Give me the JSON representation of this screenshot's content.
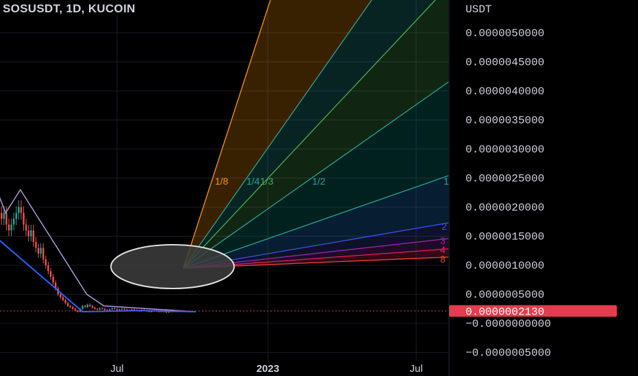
{
  "header": {
    "symbol_line": "SOSUSDT, 1D, KUCOIN"
  },
  "colors": {
    "background": "#000000",
    "up": "#26a69a",
    "down": "#ef5350",
    "price_tag": "#e53b4f",
    "text": "#d1d4dc"
  },
  "chart_data": {
    "type": "candlestick",
    "title": "SOSUSDT, 1D, KUCOIN",
    "ylabel": "USDT",
    "ylim": [
      -6e-07,
      6e-06
    ],
    "yticks": [
      "0.0000050000",
      "0.0000045000",
      "0.0000040000",
      "0.0000035000",
      "0.0000030000",
      "0.0000025000",
      "0.0000020000",
      "0.0000015000",
      "0.0000010000",
      "0.0000005000",
      "−0.0000000000",
      "−0.0000005000"
    ],
    "ytick_values": [
      5e-06,
      4.5e-06,
      4e-06,
      3.5e-06,
      3e-06,
      2.5e-06,
      2e-06,
      1.5e-06,
      1e-06,
      5e-07,
      0.0,
      -5e-07
    ],
    "xticks": [
      "Jul",
      "2023",
      "Jul"
    ],
    "xtick_dates": [
      "2022-07-01",
      "2023-01-01",
      "2023-07-01"
    ],
    "last_price": "0.0000002130",
    "last_price_value": 2.13e-07,
    "grid": true,
    "candles": {
      "start": "2022-01-08",
      "interval": "1D",
      "closes": [
        3.5e-06,
        3.1e-06,
        2.8e-06,
        2.6e-06,
        2.5e-06,
        2.3e-06,
        2.2e-06,
        2.1e-06,
        2e-06,
        2.1e-06,
        1.9e-06,
        1.8e-06,
        1.9e-06,
        1.7e-06,
        1.6e-06,
        1.7e-06,
        1.8e-06,
        1.9e-06,
        2e-06,
        1.9e-06,
        1.7e-06,
        1.6e-06,
        1.5e-06,
        1.6e-06,
        1.4e-06,
        1.3e-06,
        1.2e-06,
        1.3e-06,
        1.1e-06,
        1e-06,
        9e-07,
        8e-07,
        7e-07,
        6e-07,
        5e-07,
        4.5e-07,
        4e-07,
        3.5e-07,
        3e-07,
        2.8e-07,
        2.5e-07,
        2.2e-07,
        2e-07,
        2.5e-07,
        3e-07,
        2.8e-07,
        3.2e-07,
        3e-07,
        2.7e-07,
        2.5e-07,
        2.4e-07,
        2.6e-07,
        2.5e-07,
        2.3e-07,
        2.2e-07,
        2.4e-07,
        2.6e-07,
        2.5e-07,
        2.3e-07,
        2.4e-07,
        2.5e-07,
        2.4e-07,
        2.3e-07,
        2.2e-07,
        2.4e-07,
        2.3e-07,
        2.2e-07,
        2.1e-07,
        2.3e-07,
        2.2e-07,
        2.1e-07,
        2e-07,
        2.1e-07,
        2.2e-07,
        2.1e-07,
        2e-07,
        2.1e-07,
        2e-07,
        1.9e-07,
        2e-07,
        2.1e-07,
        2e-07,
        2.1e-07,
        2.13e-07
      ]
    },
    "annotations": {
      "channel_upper": [
        [
          "2022-01-08",
          3.3e-06
        ],
        [
          "2022-02-15",
          1.9e-06
        ],
        [
          "2022-03-05",
          2.3e-06
        ],
        [
          "2022-05-25",
          5e-07
        ],
        [
          "2022-06-15",
          3e-07
        ],
        [
          "2022-10-05",
          2e-07
        ]
      ],
      "channel_lower": [
        [
          "2022-01-08",
          1.8e-06
        ],
        [
          "2022-05-20",
          2e-07
        ],
        [
          "2022-08-01",
          2.2e-07
        ],
        [
          "2022-10-05",
          2e-07
        ]
      ],
      "gann_fan_origin": [
        "2022-09-20",
        9.5e-07
      ],
      "gann_fan_labels": [
        "1/8",
        "1/4",
        "1/3",
        "1/2",
        "1",
        "2",
        "3",
        "4",
        "8"
      ],
      "ellipse_center": [
        "2022-09-20",
        9.5e-07
      ]
    }
  }
}
